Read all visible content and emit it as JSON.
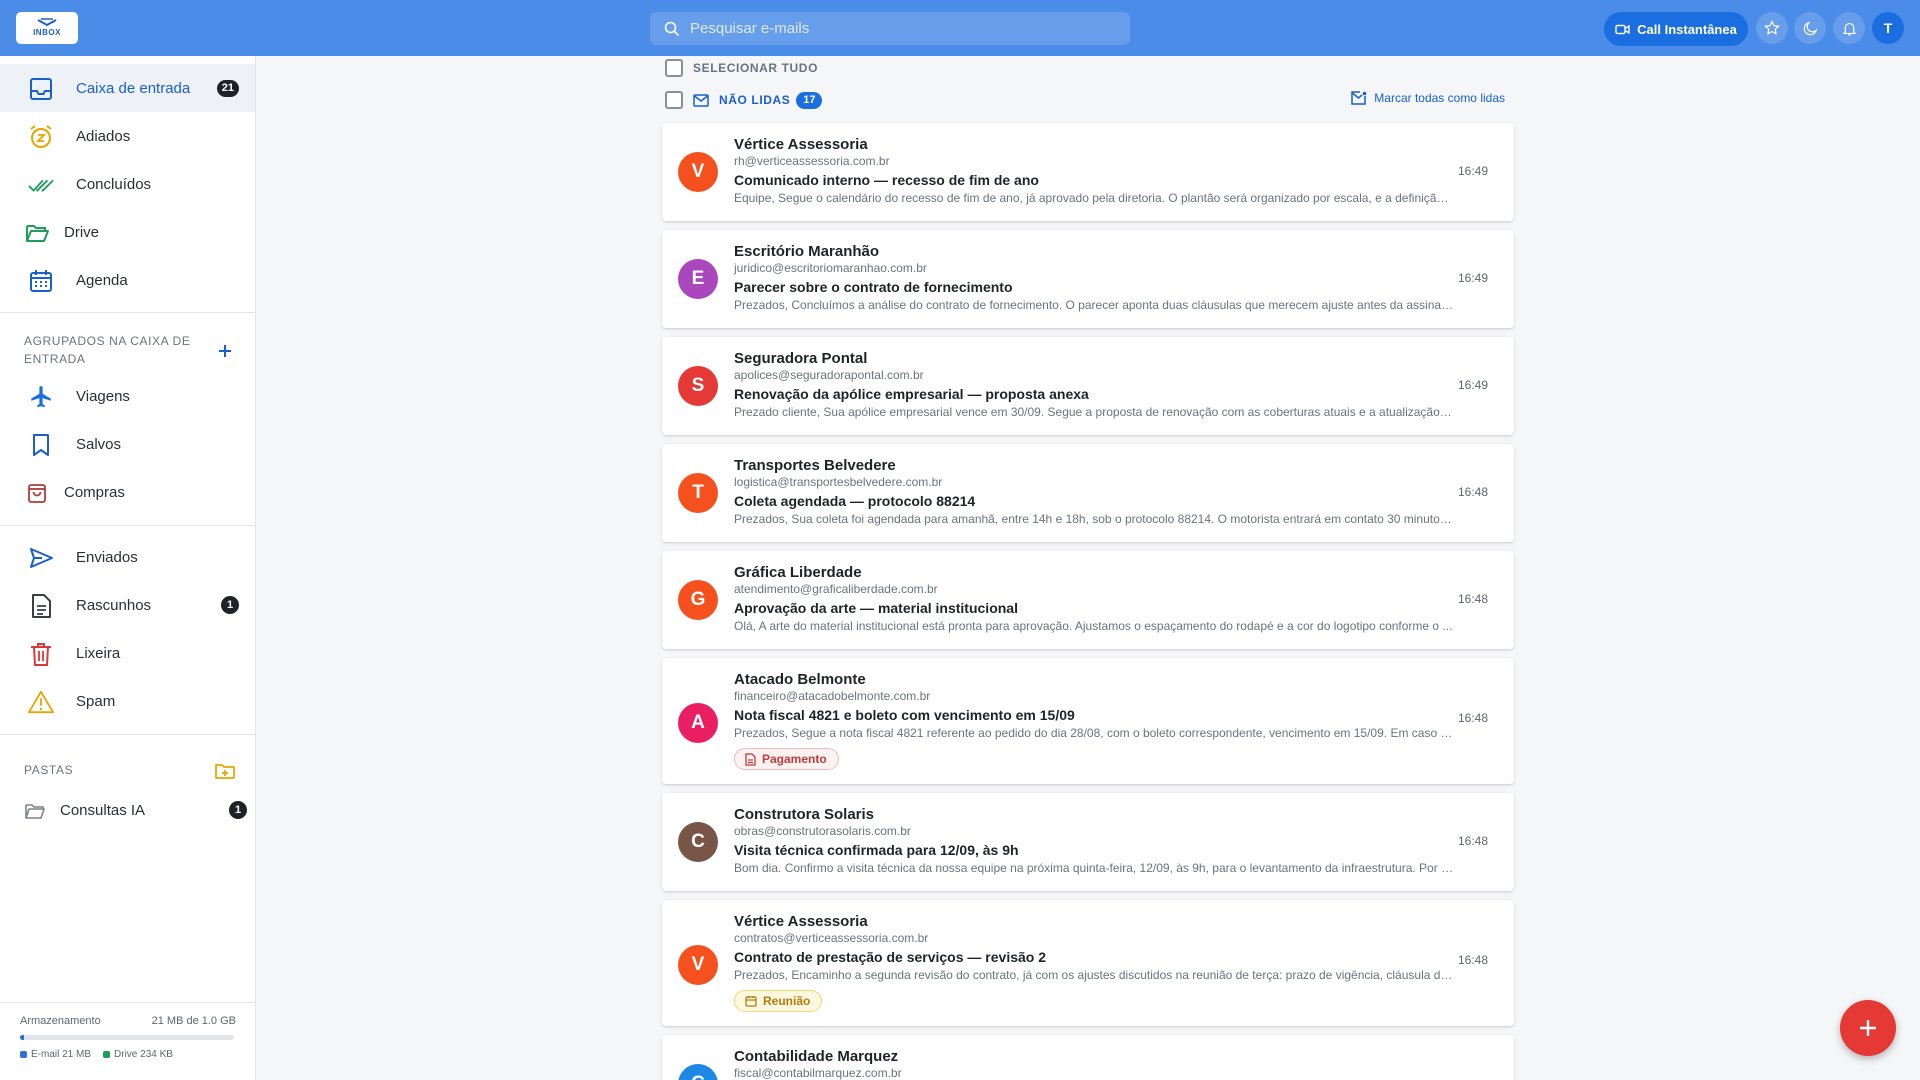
{
  "header": {
    "logo_text": "INBOX",
    "search_placeholder": "Pesquisar e-mails",
    "call_button": "Call Instantânea",
    "user_initial": "T",
    "accent": "#4a8ce8"
  },
  "sidebar": {
    "main": [
      {
        "label": "Caixa de entrada",
        "badge": "21",
        "icon": "inbox-icon",
        "active": true
      },
      {
        "label": "Adiados",
        "badge": "",
        "icon": "snooze-clock-icon"
      },
      {
        "label": "Concluídos",
        "badge": "",
        "icon": "done-all-icon"
      },
      {
        "label": "Drive",
        "badge": "",
        "icon": "folder-open-icon"
      },
      {
        "label": "Agenda",
        "badge": "",
        "icon": "calendar-icon"
      }
    ],
    "grouped_title": "AGRUPADOS NA CAIXA DE ENTRADA",
    "grouped": [
      {
        "label": "Viagens",
        "icon": "airplane-icon"
      },
      {
        "label": "Salvos",
        "icon": "bookmark-icon"
      },
      {
        "label": "Compras",
        "icon": "shopping-bag-icon"
      }
    ],
    "system": [
      {
        "label": "Enviados",
        "badge": "",
        "icon": "send-icon"
      },
      {
        "label": "Rascunhos",
        "badge": "1",
        "icon": "draft-icon"
      },
      {
        "label": "Lixeira",
        "badge": "",
        "icon": "trash-icon"
      },
      {
        "label": "Spam",
        "badge": "",
        "icon": "warning-icon"
      }
    ],
    "folders_title": "PASTAS",
    "folders": [
      {
        "label": "Consultas IA",
        "badge": "1",
        "icon": "folder-icon"
      }
    ],
    "storage": {
      "label": "Armazenamento",
      "usage": "21 MB de 1.0 GB",
      "used_fraction": 0.021,
      "email_label": "E-mail 21 MB",
      "drive_label": "Drive 234 KB",
      "email_color": "#2f6fdc",
      "drive_color": "#1e9e5a"
    }
  },
  "list": {
    "select_all": "SELECIONAR TUDO",
    "unread_label": "NÃO LIDAS",
    "unread_count": "17",
    "mark_all": "Marcar todas como lidas",
    "emails": [
      {
        "initial": "V",
        "color": "#f4511e",
        "sender": "Vértice Assessoria",
        "address": "rh@verticeassessoria.com.br",
        "subject": "Comunicado interno — recesso de fim de ano",
        "preview": "Equipe, Segue o calendário do recesso de fim de ano, já aprovado pela diretoria. O plantão será organizado por escala, e a definição d...",
        "time": "16:49",
        "tag": ""
      },
      {
        "initial": "E",
        "color": "#ab47bc",
        "sender": "Escritório Maranhão",
        "address": "juridico@escritoriomaranhao.com.br",
        "subject": "Parecer sobre o contrato de fornecimento",
        "preview": "Prezados, Concluímos a análise do contrato de fornecimento. O parecer aponta duas cláusulas que merecem ajuste antes da assinat...",
        "time": "16:49",
        "tag": ""
      },
      {
        "initial": "S",
        "color": "#e53935",
        "sender": "Seguradora Pontal",
        "address": "apolices@seguradorapontal.com.br",
        "subject": "Renovação da apólice empresarial — proposta anexa",
        "preview": "Prezado cliente, Sua apólice empresarial vence em 30/09. Segue a proposta de renovação com as coberturas atuais e a atualização d...",
        "time": "16:49",
        "tag": ""
      },
      {
        "initial": "T",
        "color": "#f4511e",
        "sender": "Transportes Belvedere",
        "address": "logistica@transportesbelvedere.com.br",
        "subject": "Coleta agendada — protocolo 88214",
        "preview": "Prezados, Sua coleta foi agendada para amanhã, entre 14h e 18h, sob o protocolo 88214. O motorista entrará em contato 30 minutos ...",
        "time": "16:48",
        "tag": ""
      },
      {
        "initial": "G",
        "color": "#f4511e",
        "sender": "Gráfica Liberdade",
        "address": "atendimento@graficaliberdade.com.br",
        "subject": "Aprovação da arte — material institucional",
        "preview": "Olá, A arte do material institucional está pronta para aprovação. Ajustamos o espaçamento do rodapé e a cor do logotipo conforme o ...",
        "time": "16:48",
        "tag": ""
      },
      {
        "initial": "A",
        "color": "#e91e63",
        "sender": "Atacado Belmonte",
        "address": "financeiro@atacadobelmonte.com.br",
        "subject": "Nota fiscal 4821 e boleto com vencimento em 15/09",
        "preview": "Prezados, Segue a nota fiscal 4821 referente ao pedido do dia 28/08, com o boleto correspondente, vencimento em 15/09. Em caso d...",
        "time": "16:48",
        "tag": "Pagamento",
        "tag_type": "pay"
      },
      {
        "initial": "C",
        "color": "#795548",
        "sender": "Construtora Solaris",
        "address": "obras@construtorasolaris.com.br",
        "subject": "Visita técnica confirmada para 12/09, às 9h",
        "preview": "Bom dia. Confirmo a visita técnica da nossa equipe na próxima quinta-feira, 12/09, às 9h, para o levantamento da infraestrutura. Por g...",
        "time": "16:48",
        "tag": ""
      },
      {
        "initial": "V",
        "color": "#f4511e",
        "sender": "Vértice Assessoria",
        "address": "contratos@verticeassessoria.com.br",
        "subject": "Contrato de prestação de serviços — revisão 2",
        "preview": "Prezados, Encaminho a segunda revisão do contrato, já com os ajustes discutidos na reunião de terça: prazo de vigência, cláusula de r...",
        "time": "16:48",
        "tag": "Reunião",
        "tag_type": "meet"
      },
      {
        "initial": "C",
        "color": "#1e88e5",
        "sender": "Contabilidade Marquez",
        "address": "fiscal@contabilmarquez.com.br",
        "subject": "",
        "preview": "",
        "time": "",
        "tag": ""
      }
    ]
  }
}
